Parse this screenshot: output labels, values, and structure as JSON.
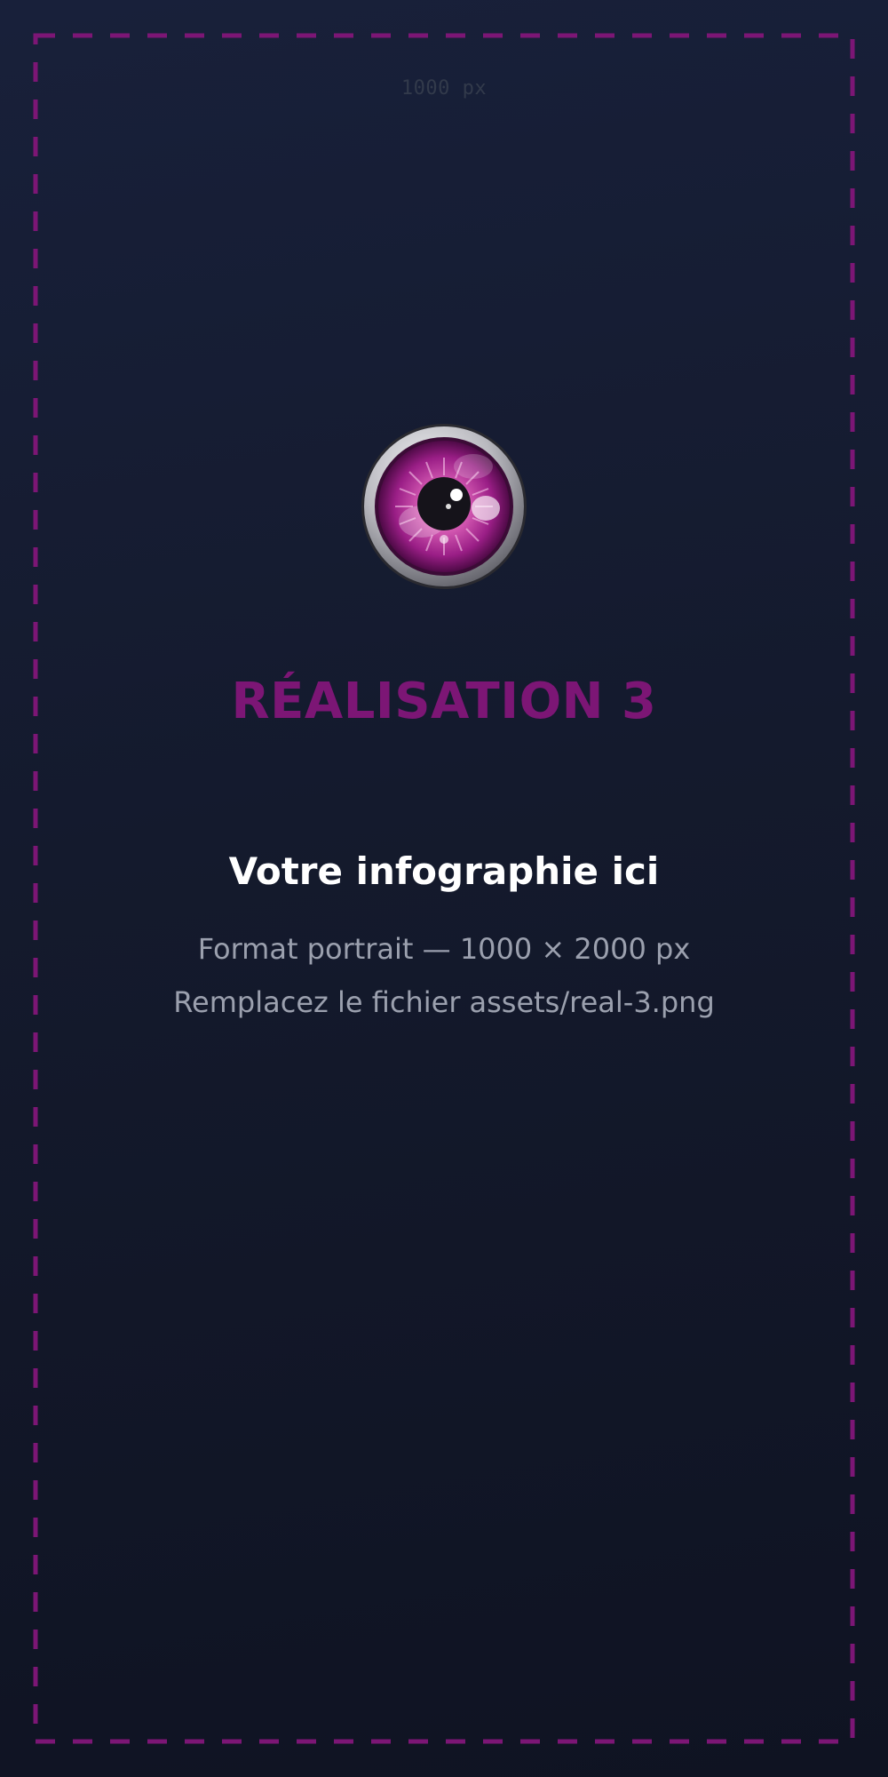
{
  "canvas_label": "1000 px",
  "logo": {
    "icon": "eye-icon"
  },
  "title": "RÉALISATION 3",
  "placeholder": {
    "heading": "Votre infographie ici",
    "format_line": "Format portrait — 1000 × 2000 px",
    "replace_prefix": "Remplacez le fichier",
    "file_path": "assets/real-3.png"
  },
  "colors": {
    "accent": "#7c1675",
    "frame_border": "#7c1675",
    "background": "#141a2d",
    "heading": "#ffffff",
    "muted_text": "#9ba0ae",
    "dim_label": "#323a4b"
  }
}
